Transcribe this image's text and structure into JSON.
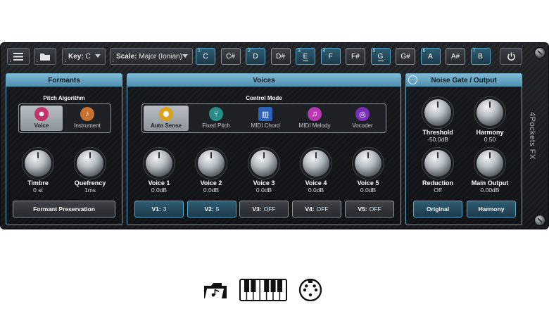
{
  "toolbar": {
    "menu_icon": "hamburger-icon",
    "folder_icon": "folder-icon",
    "key_label": "Key:",
    "key_value": "C",
    "scale_label": "Scale:",
    "scale_value": "Major (Ionian)",
    "power_icon": "power-icon",
    "notes": [
      {
        "name": "C",
        "number": "1",
        "type": "natural",
        "underline": false
      },
      {
        "name": "C#",
        "number": "",
        "type": "sharp",
        "underline": false
      },
      {
        "name": "D",
        "number": "2",
        "type": "natural",
        "underline": false
      },
      {
        "name": "D#",
        "number": "",
        "type": "sharp",
        "underline": false
      },
      {
        "name": "E",
        "number": "3",
        "type": "natural",
        "underline": true
      },
      {
        "name": "F",
        "number": "4",
        "type": "natural",
        "underline": false
      },
      {
        "name": "F#",
        "number": "",
        "type": "sharp",
        "underline": false
      },
      {
        "name": "G",
        "number": "5",
        "type": "natural",
        "underline": true
      },
      {
        "name": "G#",
        "number": "",
        "type": "sharp",
        "underline": false
      },
      {
        "name": "A",
        "number": "6",
        "type": "natural",
        "underline": false
      },
      {
        "name": "A#",
        "number": "",
        "type": "sharp",
        "underline": false
      },
      {
        "name": "B",
        "number": "7",
        "type": "natural",
        "underline": false
      }
    ]
  },
  "formants": {
    "title": "Formants",
    "pitch_algorithm_label": "Pitch Algorithm",
    "algorithms": [
      {
        "label": "Voice",
        "icon": "voice-icon",
        "selected": true
      },
      {
        "label": "Instrument",
        "icon": "guitar-icon",
        "selected": false
      }
    ],
    "knobs": [
      {
        "label": "Timbre",
        "value": "0 st"
      },
      {
        "label": "Quefrency",
        "value": "1ms"
      }
    ],
    "preservation_button": "Formant Preservation"
  },
  "voices": {
    "title": "Voices",
    "control_mode_label": "Control Mode",
    "modes": [
      {
        "label": "Auto Sense",
        "icon": "auto-sense-icon",
        "selected": true
      },
      {
        "label": "Fixed Pitch",
        "icon": "tuning-fork-icon",
        "selected": false
      },
      {
        "label": "MIDI Chord",
        "icon": "piano-icon",
        "selected": false
      },
      {
        "label": "MIDI Melody",
        "icon": "music-note-icon",
        "selected": false
      },
      {
        "label": "Vocoder",
        "icon": "vocoder-icon",
        "selected": false
      }
    ],
    "knobs": [
      {
        "label": "Voice 1",
        "value": "0.0dB"
      },
      {
        "label": "Voice 2",
        "value": "0.0dB"
      },
      {
        "label": "Voice 3",
        "value": "0.0dB"
      },
      {
        "label": "Voice 4",
        "value": "0.0dB"
      },
      {
        "label": "Voice 5",
        "value": "0.0dB"
      }
    ],
    "buttons": [
      {
        "name": "V1:",
        "value": "3",
        "active": true
      },
      {
        "name": "V2:",
        "value": "5",
        "active": true
      },
      {
        "name": "V3:",
        "value": "OFF",
        "active": false
      },
      {
        "name": "V4:",
        "value": "OFF",
        "active": false
      },
      {
        "name": "V5:",
        "value": "OFF",
        "active": false
      }
    ]
  },
  "noise_gate": {
    "title": "Noise Gate / Output",
    "knobs": [
      {
        "label": "Threshold",
        "value": "-50.0dB"
      },
      {
        "label": "Harmony",
        "value": "0.50"
      },
      {
        "label": "Reduction",
        "value": "Off"
      },
      {
        "label": "Main Output",
        "value": "0.00dB"
      }
    ],
    "buttons": [
      "Original",
      "Harmony"
    ]
  },
  "brand": "4Pockets FX",
  "bottom_icons": [
    "folder-music-icon",
    "piano-keyboard-icon",
    "midi-port-icon"
  ],
  "colors": {
    "accent": "#5aa8c9",
    "panel_header": "#6aa6c4"
  }
}
